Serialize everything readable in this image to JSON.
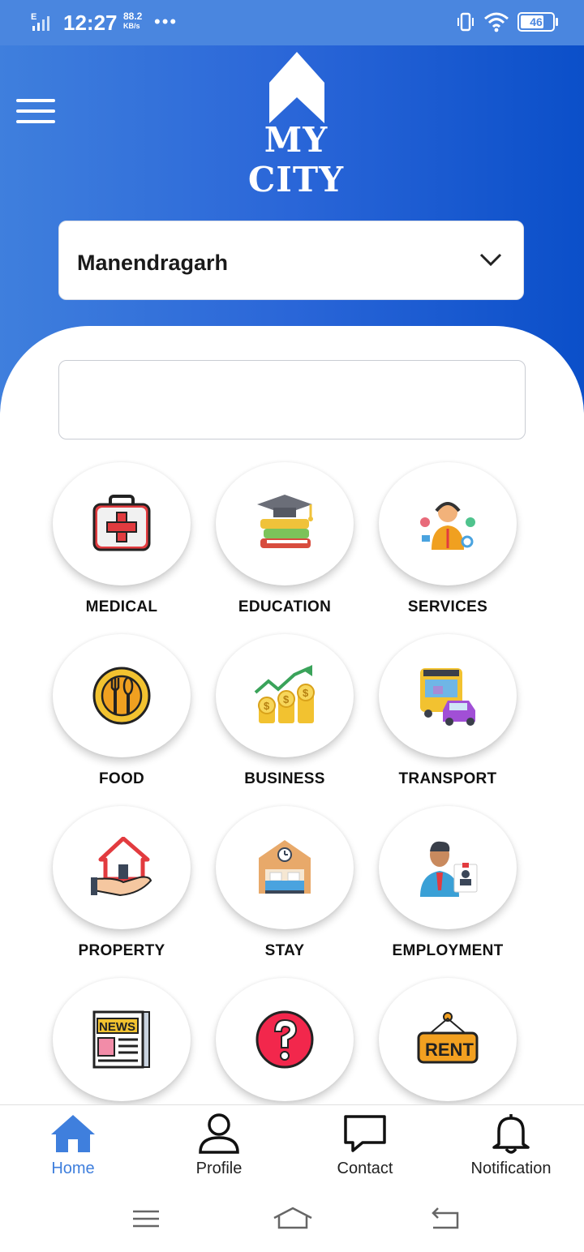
{
  "status_bar": {
    "time": "12:27",
    "network_type": "E",
    "speed_value": "88.2",
    "speed_unit": "KB/s",
    "more": "•••",
    "battery_level": "46"
  },
  "header": {
    "logo_text": "MY CITY",
    "menu_icon": "hamburger-menu-icon"
  },
  "city_select": {
    "value": "Manendragarh",
    "icon": "chevron-down-icon"
  },
  "search": {
    "value": ""
  },
  "categories": [
    {
      "label": "MEDICAL",
      "icon": "first-aid-kit-icon"
    },
    {
      "label": "EDUCATION",
      "icon": "graduation-books-icon"
    },
    {
      "label": "SERVICES",
      "icon": "customer-support-icon"
    },
    {
      "label": "FOOD",
      "icon": "plate-cutlery-icon"
    },
    {
      "label": "BUSINESS",
      "icon": "growth-coins-icon"
    },
    {
      "label": "TRANSPORT",
      "icon": "bus-car-icon"
    },
    {
      "label": "PROPERTY",
      "icon": "house-hand-icon"
    },
    {
      "label": "STAY",
      "icon": "hotel-bed-icon"
    },
    {
      "label": "EMPLOYMENT",
      "icon": "businessman-id-icon"
    },
    {
      "label": "",
      "icon": "newspaper-icon",
      "badge_text": "NEWS"
    },
    {
      "label": "",
      "icon": "question-mark-icon"
    },
    {
      "label": "",
      "icon": "rent-sign-icon",
      "badge_text": "RENT"
    }
  ],
  "bottom_nav": [
    {
      "label": "Home",
      "icon": "home-icon",
      "active": true
    },
    {
      "label": "Profile",
      "icon": "user-icon",
      "active": false
    },
    {
      "label": "Contact",
      "icon": "chat-bubble-icon",
      "active": false
    },
    {
      "label": "Notification",
      "icon": "bell-icon",
      "active": false
    }
  ],
  "colors": {
    "header_gradient_start": "#3f7fdd",
    "header_gradient_end": "#0b4fc9",
    "active_tab": "#3f7fdd"
  }
}
